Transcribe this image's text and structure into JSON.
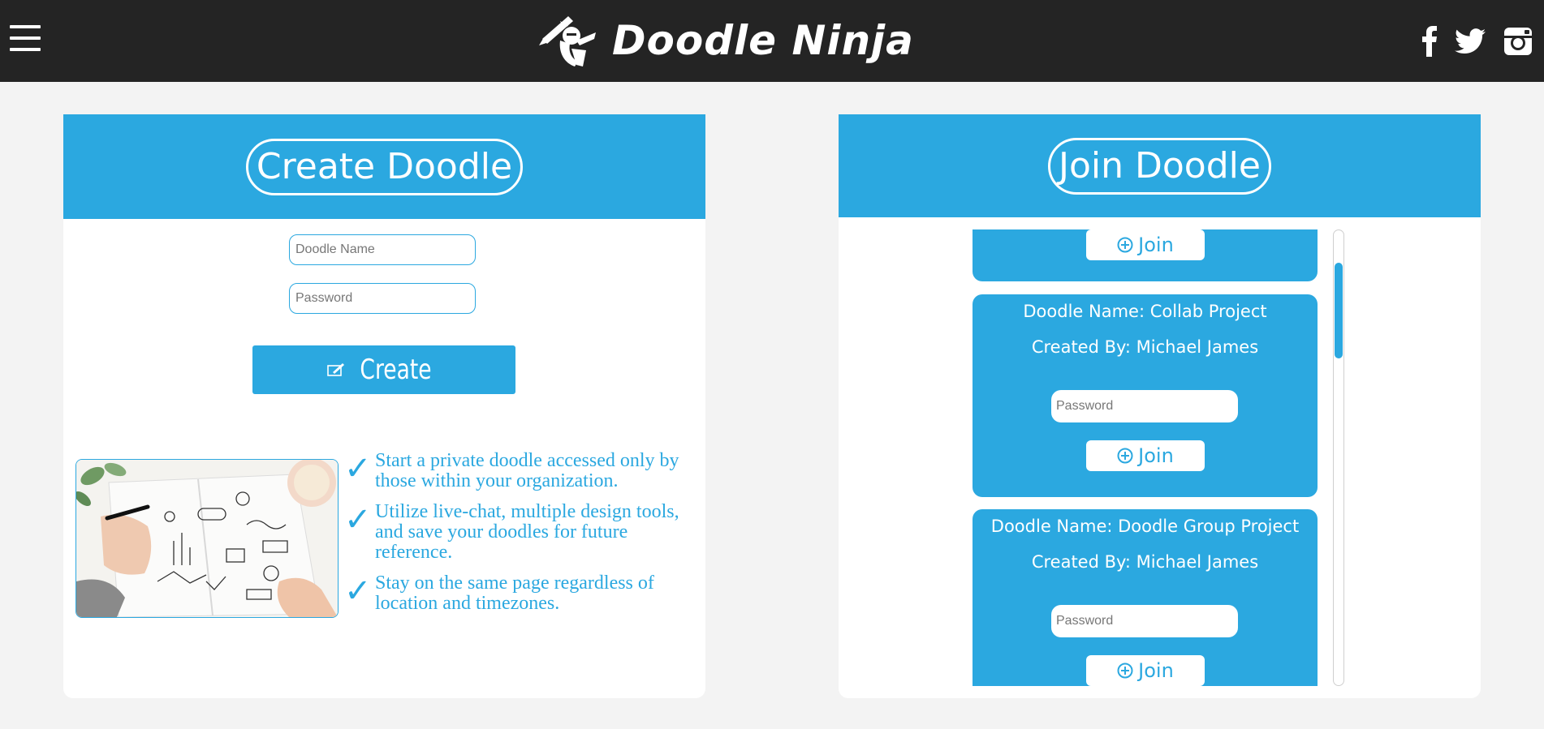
{
  "header": {
    "brand_name": "Doodle Ninja",
    "menu_icon": "hamburger-menu-icon",
    "social": [
      "facebook-icon",
      "twitter-icon",
      "instagram-icon"
    ]
  },
  "create_panel": {
    "title": "Create Doodle",
    "name_placeholder": "Doodle Name",
    "password_placeholder": "Password",
    "create_label": "Create",
    "features": [
      "Start a private doodle accessed only by those within your organization.",
      "Utilize live-chat, multiple design tools, and save your doodles for future reference.",
      "Stay on the same page regardless of location and timezones."
    ],
    "check_glyph": "✓"
  },
  "join_panel": {
    "title": "Join Doodle",
    "join_label": "Join",
    "password_placeholder": "Password",
    "doodles": [
      {
        "name": "Doodle Name: Collab Project",
        "creator": "Created By: Michael James"
      },
      {
        "name": "Doodle Name: Doodle Group Project",
        "creator": "Created By: Michael James"
      }
    ]
  },
  "colors": {
    "accent": "#2ba8e0",
    "header_bg": "#242424",
    "page_bg": "#f3f3f3"
  }
}
